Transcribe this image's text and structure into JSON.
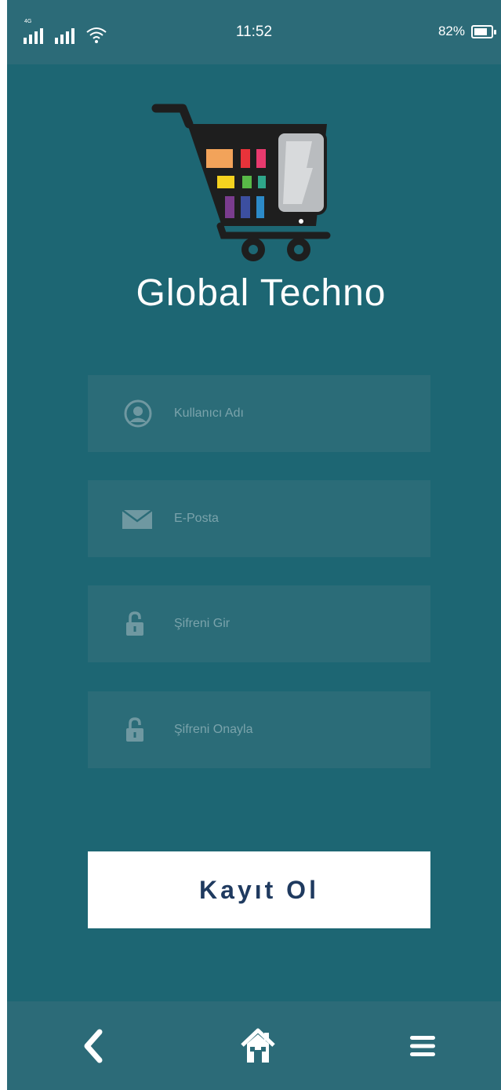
{
  "status_bar": {
    "network_label": "4G",
    "time": "11:52",
    "battery_percent": "82%",
    "battery_level": 0.82
  },
  "app": {
    "title": "Global Techno",
    "logo_icon": "shopping-cart-with-phone-icon"
  },
  "form": {
    "username": {
      "placeholder": "Kullanıcı Adı",
      "value": "",
      "icon": "user-avatar-icon"
    },
    "email": {
      "placeholder": "E-Posta",
      "value": "",
      "icon": "envelope-icon"
    },
    "password": {
      "placeholder": "Şifreni Gir",
      "value": "",
      "icon": "lock-icon"
    },
    "password_confirm": {
      "placeholder": "Şifreni Onayla",
      "value": "",
      "icon": "lock-icon"
    },
    "submit_label": "Kayıt Ol"
  },
  "nav": {
    "back_icon": "chevron-left-icon",
    "home_icon": "home-icon",
    "menu_icon": "hamburger-menu-icon"
  },
  "colors": {
    "background": "#1d6673",
    "bar": "#2c6b78",
    "field": "#2b6c78",
    "button_text": "#1f3a5f"
  }
}
